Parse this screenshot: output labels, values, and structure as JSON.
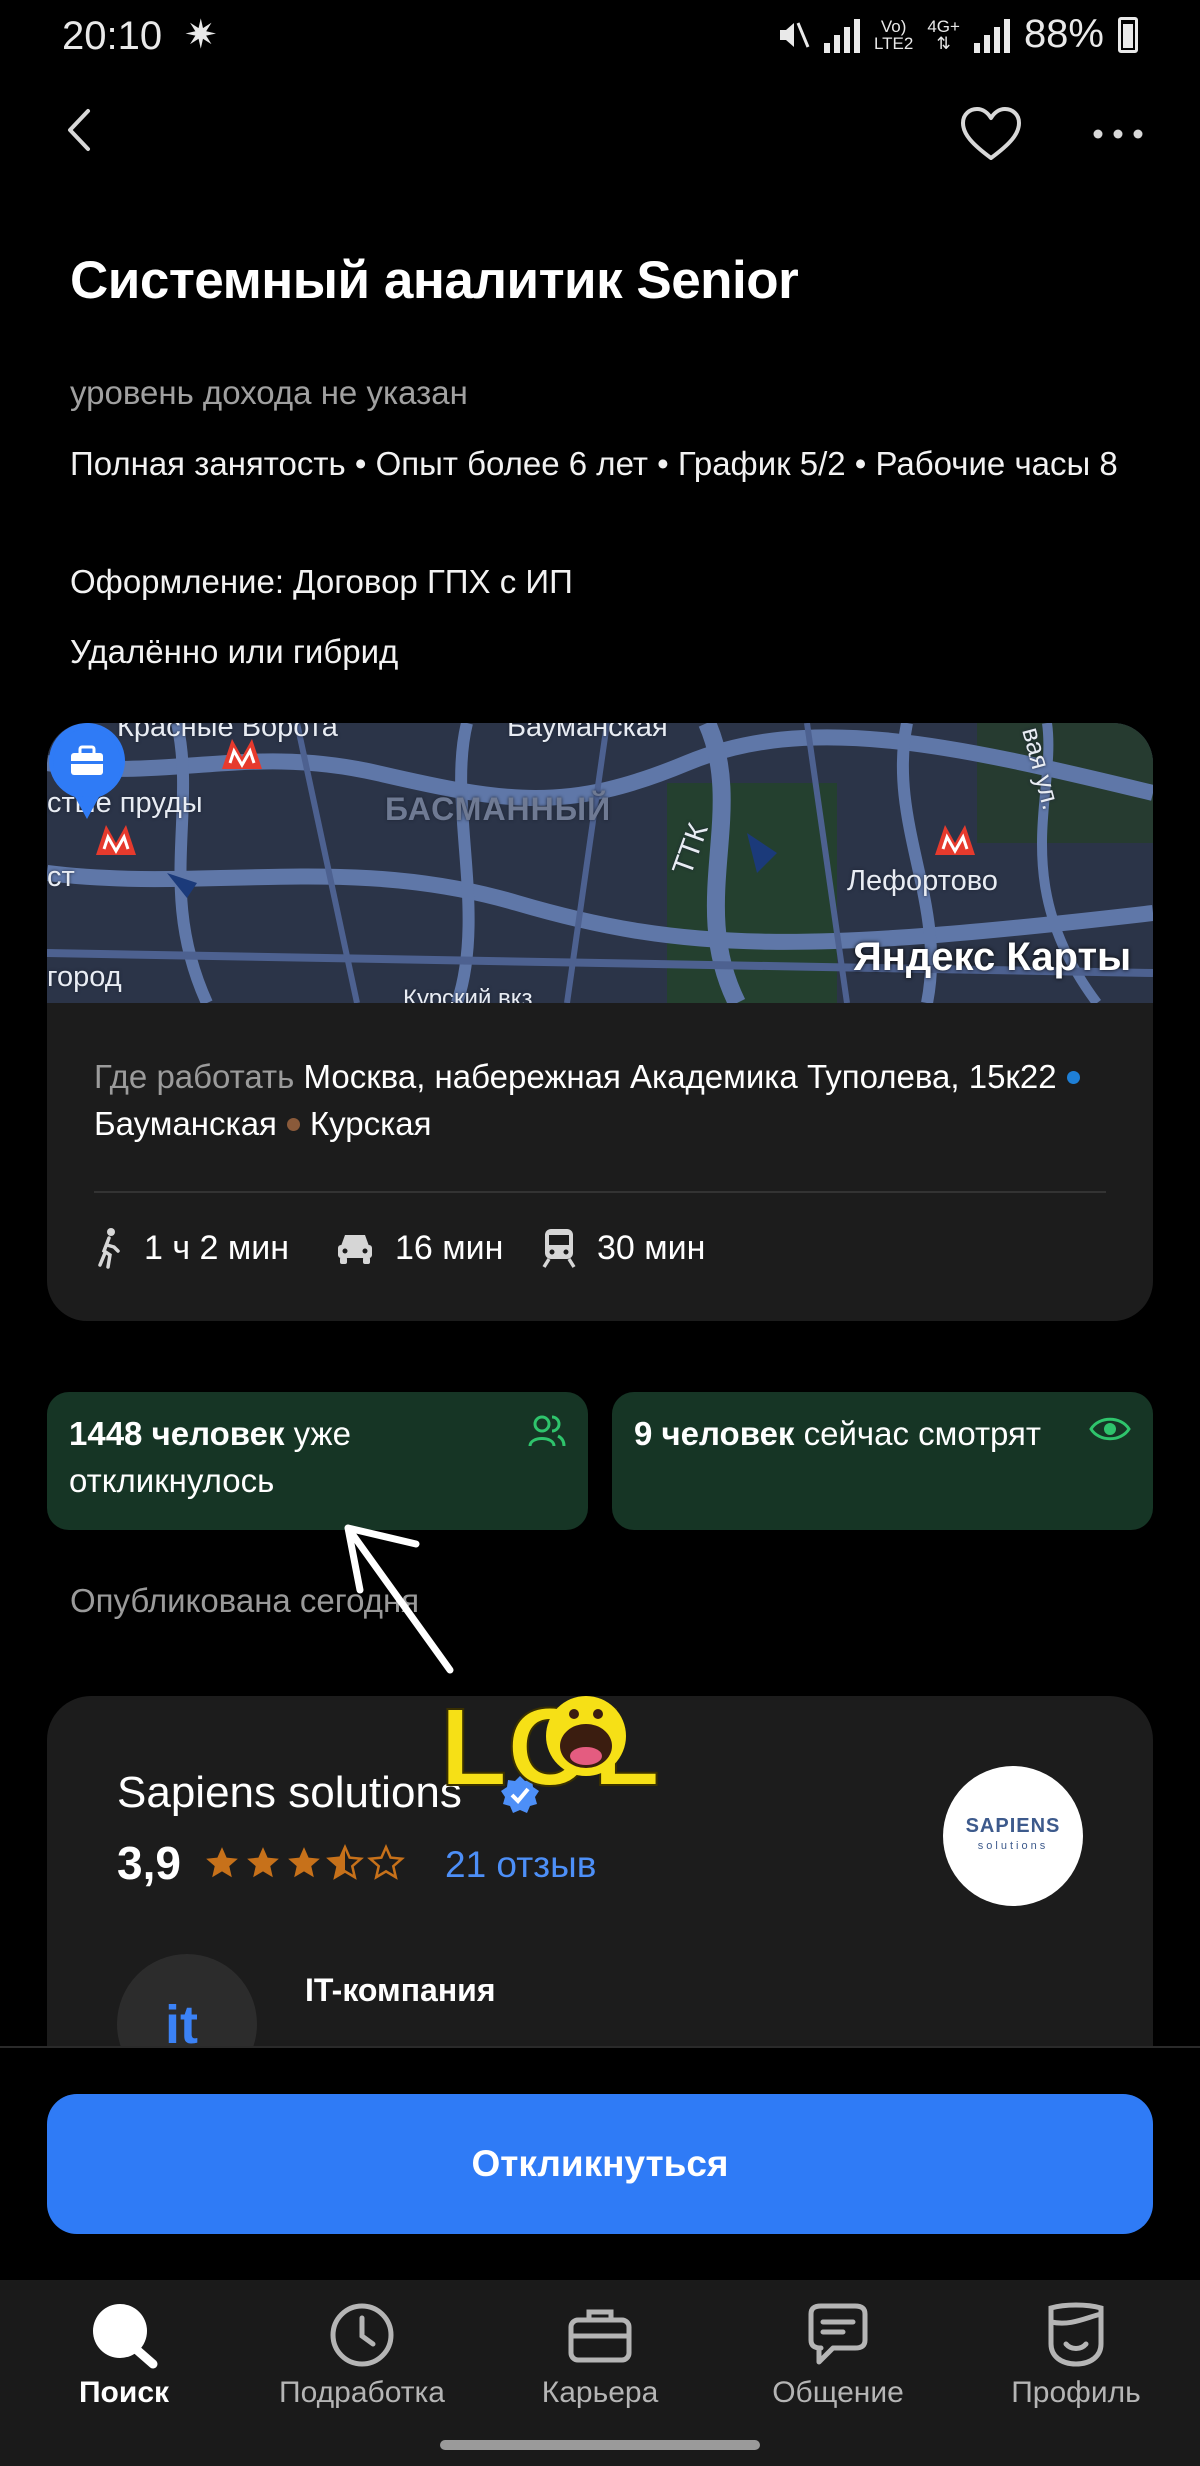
{
  "status_bar": {
    "time": "20:10",
    "lte_label_top": "Vo)",
    "lte_label_bottom": "LTE2",
    "net_label": "4G+",
    "battery": "88%"
  },
  "job": {
    "title": "Системный аналитик Senior",
    "salary": "уровень дохода не указан",
    "employment": "Полная занятость • Опыт более 6 лет • График 5/2 • Рабочие часы 8",
    "contract": "Оформление: Договор ГПХ с ИП",
    "work_format": "Удалённо или гибрид"
  },
  "map": {
    "labels": {
      "krasnye_vorota": "Красные Ворота",
      "baumanskaya": "Бауманская",
      "chistye_prudy": "стые пруды",
      "basmanny": "БАСМАННЫЙ",
      "ttk": "ТТК",
      "lefortovo": "Лефортово",
      "st": "ст",
      "gorod": "город",
      "kursky": "Курский вкз",
      "street": "вая ул."
    },
    "logo": "Яндекс Карты"
  },
  "location": {
    "label": "Где работать",
    "address": "Москва, набережная Академика Туполева, 15к22",
    "metro": [
      {
        "name": "Бауманская",
        "color": "#1e7fd6"
      },
      {
        "name": "Курская",
        "color": "#8a5a3a"
      }
    ],
    "routes": {
      "walk": "1 ч 2 мин",
      "car": "16 мин",
      "transit": "30 мин"
    }
  },
  "stats": {
    "responded_bold": "1448 человек",
    "responded_rest": "уже откликнулось",
    "viewing_bold": "9 человек",
    "viewing_rest": "сейчас смотрят"
  },
  "published": "Опубликована сегодня",
  "company": {
    "name": "Sapiens solutions",
    "rating": "3,9",
    "reviews": "21 отзыв",
    "logo_text": "SAPIENS",
    "logo_sub": "solutions",
    "type": "IT-компания",
    "type_icon": "it",
    "stars": 3.5
  },
  "actions": {
    "apply": "Откликнуться"
  },
  "nav": {
    "search": "Поиск",
    "side_job": "Подработка",
    "career": "Карьера",
    "chat": "Общение",
    "profile": "Профиль"
  },
  "sticker": {
    "text": "LOL"
  },
  "colors": {
    "accent": "#2f7bf6",
    "stat_bg": "#163525",
    "stat_icon": "#2fc46c",
    "star": "#c7711a",
    "link": "#4d8ff7"
  }
}
